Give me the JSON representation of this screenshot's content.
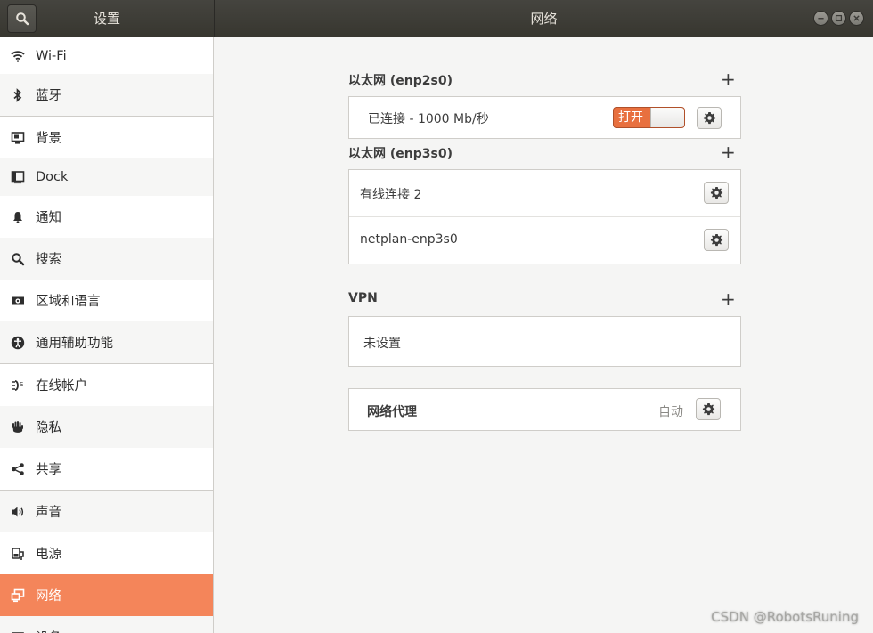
{
  "header": {
    "left_title": "设置",
    "main_title": "网络"
  },
  "sidebar": {
    "items": [
      {
        "label": "Wi-Fi",
        "icon": "wifi-icon"
      },
      {
        "label": "蓝牙",
        "icon": "bluetooth-icon"
      },
      {
        "label": "背景",
        "icon": "background-icon"
      },
      {
        "label": "Dock",
        "icon": "dock-icon"
      },
      {
        "label": "通知",
        "icon": "bell-icon"
      },
      {
        "label": "搜索",
        "icon": "search-icon"
      },
      {
        "label": "区域和语言",
        "icon": "region-icon"
      },
      {
        "label": "通用辅助功能",
        "icon": "accessibility-icon"
      },
      {
        "label": "在线帐户",
        "icon": "online-accounts-icon"
      },
      {
        "label": "隐私",
        "icon": "hand-icon"
      },
      {
        "label": "共享",
        "icon": "share-icon"
      },
      {
        "label": "声音",
        "icon": "speaker-icon"
      },
      {
        "label": "电源",
        "icon": "power-icon"
      },
      {
        "label": "网络",
        "icon": "network-icon",
        "active": true
      },
      {
        "label": "设备",
        "icon": "devices-icon"
      }
    ]
  },
  "main": {
    "eth1": {
      "title": "以太网 (enp2s0)",
      "status": "已连接 - 1000 Mb/秒",
      "switch_label": "打开"
    },
    "eth2": {
      "title": "以太网 (enp3s0)",
      "connections": [
        "有线连接 2",
        "netplan-enp3s0"
      ]
    },
    "vpn": {
      "title": "VPN",
      "empty": "未设置"
    },
    "proxy": {
      "label": "网络代理",
      "value": "自动"
    }
  },
  "watermark": "CSDN @RobotsRuning",
  "colors": {
    "accent": "#f4855a",
    "switch_on": "#e8703f",
    "headerbar": "#3b3a36"
  }
}
